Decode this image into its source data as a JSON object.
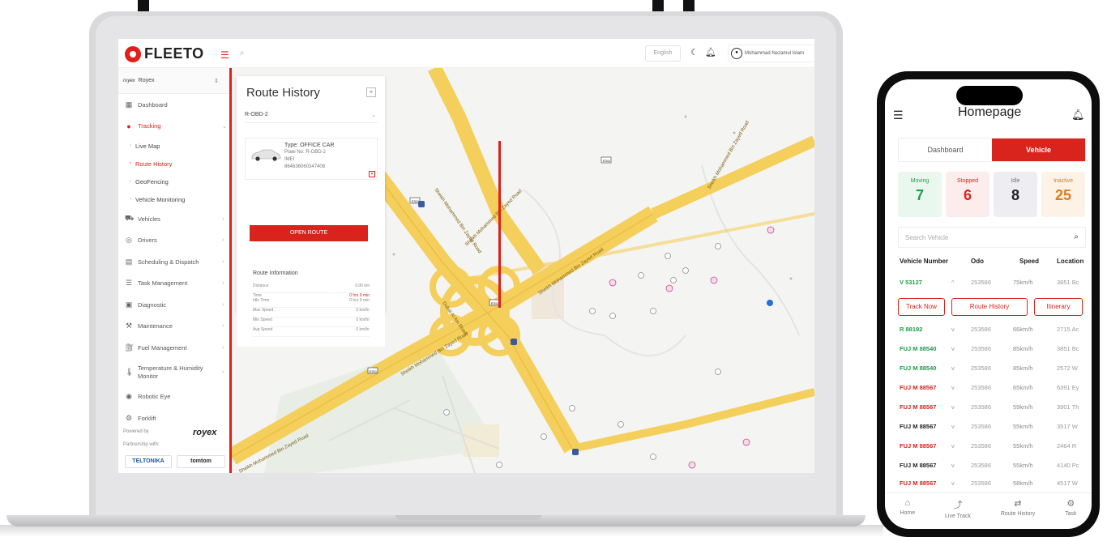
{
  "app": {
    "brand": "FLEETO",
    "language": "English",
    "user": "Mohammad Nezamul Islam"
  },
  "sidebar": {
    "company": "Royex",
    "company_logo": "royex",
    "items": [
      {
        "label": "Dashboard",
        "icon": "grid-icon"
      },
      {
        "label": "Tracking",
        "icon": "pin-icon",
        "sub": [
          "Live Map",
          "Route History",
          "GeoFencing",
          "Vehicle Monitoring"
        ]
      },
      {
        "label": "Vehicles",
        "icon": "car-icon"
      },
      {
        "label": "Drivers",
        "icon": "steering-icon"
      },
      {
        "label": "Scheduling & Dispatch",
        "icon": "calendar-icon"
      },
      {
        "label": "Task Management",
        "icon": "list-icon"
      },
      {
        "label": "Diagnostic",
        "icon": "clipboard-icon"
      },
      {
        "label": "Maintenance",
        "icon": "wrench-icon"
      },
      {
        "label": "Fuel Management",
        "icon": "fuel-icon"
      },
      {
        "label": "Temperature & Humidity Monitor",
        "icon": "thermometer-icon"
      },
      {
        "label": "Robotic Eye",
        "icon": "camera-icon"
      },
      {
        "label": "Forklift",
        "icon": "forklift-icon"
      }
    ],
    "powered_by": "Powered by",
    "powered_brand": "royex",
    "partnership": "Partnership with:",
    "partners": [
      "TELTONIKA",
      "tomtom"
    ]
  },
  "route_panel": {
    "title": "Route History",
    "selected_vehicle": "R-OBD-2",
    "vehicle_type": "Type: OFFICE CAR",
    "plate": "Plate No: R-OBD-2",
    "imei_label": "IMEI",
    "imei": "864636060347408",
    "open_button": "OPEN ROUTE",
    "info_title": "Route Information",
    "info_rows": [
      {
        "label": "Distance",
        "value": "0.00 km"
      },
      {
        "label": "Time",
        "value": "0 hrs 0 min",
        "red": true
      },
      {
        "label": "Idle Time",
        "value": "0 hrs 0 min"
      },
      {
        "label": "Max Speed",
        "value": "0 km/hr"
      },
      {
        "label": "Min Speed",
        "value": "0 km/hr"
      },
      {
        "label": "Avg Speed",
        "value": "0 km/hr"
      }
    ]
  },
  "map": {
    "road_labels": [
      "Sheikh Mohammed Bin Zayed Road",
      "Sheikh Mohammed Bin Zayed Road",
      "Sheikh Mohammed Bin Zayed Road",
      "Sheikh Mohammed Bin Zayed Road",
      "Sheikh Mohammed Bin Zayed Road",
      "Sheikh Mohammed Bin Zayed Road",
      "Dubai Al Ain Road"
    ],
    "shields": [
      "E311",
      "E311",
      "E311",
      "E311"
    ]
  },
  "phone": {
    "title": "Homepage",
    "tabs": [
      "Dashboard",
      "Vehicle"
    ],
    "stats": [
      {
        "label": "Moving",
        "value": "7",
        "color": "#1f9c4a",
        "bg": "#eaf7ee"
      },
      {
        "label": "Stopped",
        "value": "6",
        "color": "#d9231d",
        "bg": "#fdecec"
      },
      {
        "label": "Idle",
        "value": "8",
        "color": "#222222",
        "bg": "#eeeef2"
      },
      {
        "label": "Inactive",
        "value": "25",
        "color": "#e07b1a",
        "bg": "#fdf2e6"
      }
    ],
    "search_placeholder": "Search Vehicle",
    "columns": [
      "Vehicle Number",
      "Odo",
      "Speed",
      "Location"
    ],
    "rows": [
      {
        "num": "V 53127",
        "odo": "253586",
        "speed": "75km/h",
        "loc": "3851 Bc",
        "color": "#1f9c4a",
        "arrow": "^"
      },
      {
        "num": "R 88192",
        "odo": "253586",
        "speed": "66km/h",
        "loc": "2715 Ac",
        "color": "#1f9c4a",
        "arrow": "v"
      },
      {
        "num": "FUJ M 88540",
        "odo": "253586",
        "speed": "85km/h",
        "loc": "3851 Bc",
        "color": "#1f9c4a",
        "arrow": "v"
      },
      {
        "num": "FUJ M 88540",
        "odo": "253586",
        "speed": "85km/h",
        "loc": "2572 W",
        "color": "#1f9c4a",
        "arrow": "v"
      },
      {
        "num": "FUJ M 88567",
        "odo": "253586",
        "speed": "65km/h",
        "loc": "6391 Ey",
        "color": "#d9231d",
        "arrow": "v"
      },
      {
        "num": "FUJ M 88567",
        "odo": "253586",
        "speed": "59km/h",
        "loc": "3901 Th",
        "color": "#d9231d",
        "arrow": "v"
      },
      {
        "num": "FUJ M 88567",
        "odo": "253586",
        "speed": "55km/h",
        "loc": "3517 W",
        "color": "#222222",
        "arrow": "v"
      },
      {
        "num": "FUJ M 88567",
        "odo": "253586",
        "speed": "55km/h",
        "loc": "2464 R",
        "color": "#d9231d",
        "arrow": "v"
      },
      {
        "num": "FUJ M 88567",
        "odo": "253586",
        "speed": "55km/h",
        "loc": "4140 Pc",
        "color": "#222222",
        "arrow": "v"
      },
      {
        "num": "FUJ M 88567",
        "odo": "253586",
        "speed": "58km/h",
        "loc": "4517 W",
        "color": "#d9231d",
        "arrow": "v"
      }
    ],
    "row_actions": [
      "Track Now",
      "Route History",
      "Itinerary"
    ],
    "bottom_nav": [
      {
        "label": "Home",
        "icon": "home-icon"
      },
      {
        "label": "Live Track",
        "icon": "route-icon"
      },
      {
        "label": "Route History",
        "icon": "history-icon"
      },
      {
        "label": "Task",
        "icon": "task-icon"
      }
    ]
  },
  "colors": {
    "accent": "#d9231d",
    "road": "#f5cf5b",
    "map_bg": "#f4f4f2"
  }
}
